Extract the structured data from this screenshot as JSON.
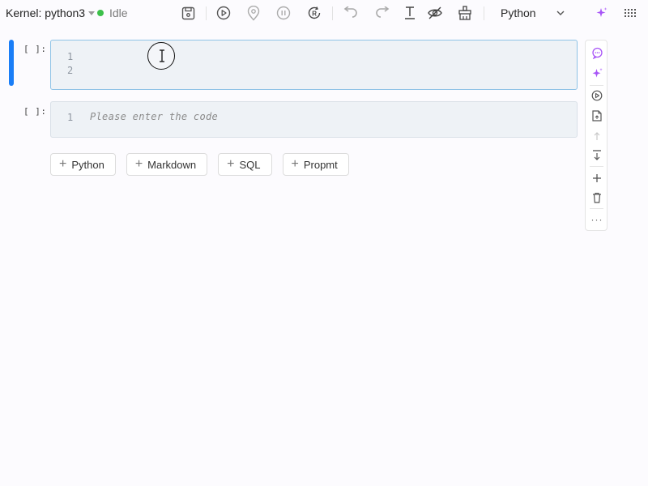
{
  "toolbar": {
    "kernel_label": "Kernel: python3",
    "status_text": "Idle",
    "status_color": "#3cc04a",
    "language": "Python",
    "icons": [
      "save-icon",
      "run-icon",
      "location-pin-icon",
      "pause-icon",
      "restart-icon",
      "undo-icon",
      "redo-icon",
      "text-cursor-icon",
      "eye-off-icon",
      "clear-icon",
      "dropdown-chevron-icon",
      "sparkle-ai-icon",
      "apps-grid-icon"
    ]
  },
  "cells": [
    {
      "prompt": "[ ]:",
      "line_numbers": [
        "1",
        "2"
      ],
      "code": ""
    },
    {
      "prompt": "[ ]:",
      "line_numbers": [
        "1"
      ],
      "placeholder": "Please enter the code"
    }
  ],
  "add_buttons": [
    {
      "label": "Python"
    },
    {
      "label": "Markdown"
    },
    {
      "label": "SQL"
    },
    {
      "label": "Propmt"
    }
  ],
  "side_panel": {
    "icons": [
      "chat-icon",
      "sparkle-icon",
      "run-cell-icon",
      "doc-export-icon",
      "move-up-icon",
      "move-top-icon",
      "add-icon",
      "delete-icon"
    ],
    "more_label": "···"
  },
  "colors": {
    "accent": "#1a7ef7",
    "ai_purple": "#a855f7"
  }
}
